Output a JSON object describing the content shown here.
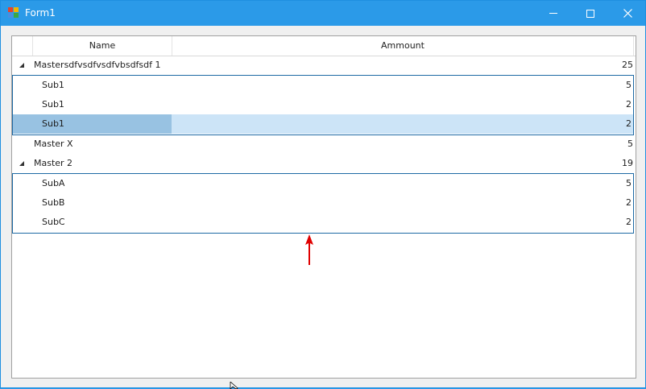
{
  "window": {
    "title": "Form1"
  },
  "titlebar_buttons": {
    "minimize_icon": "minimize-icon",
    "maximize_icon": "maximize-icon",
    "close_icon": "close-icon"
  },
  "grid": {
    "columns": [
      "Name",
      "Ammount"
    ],
    "masters": [
      {
        "name": "Mastersdfvsdfvsdfvbsdfsdf 1",
        "amount": "25",
        "expanded": true,
        "details": [
          {
            "name": "Sub1",
            "amount": "5"
          },
          {
            "name": "Sub1",
            "amount": "2"
          },
          {
            "name": "Sub1",
            "amount": "2",
            "selected": true
          }
        ]
      },
      {
        "name": "Master X",
        "amount": "5",
        "expanded": false,
        "details": []
      },
      {
        "name": "Master 2",
        "amount": "19",
        "expanded": true,
        "details": [
          {
            "name": "SubA",
            "amount": "5"
          },
          {
            "name": "SubB",
            "amount": "2"
          },
          {
            "name": "SubC",
            "amount": "2"
          }
        ]
      }
    ]
  },
  "colors": {
    "titlebar": "#2b9ae8",
    "selection": "#cce4f7",
    "selection_cell": "#98c2e2",
    "detail_border": "#1e6aa5",
    "annotation_arrow": "#e00000"
  }
}
